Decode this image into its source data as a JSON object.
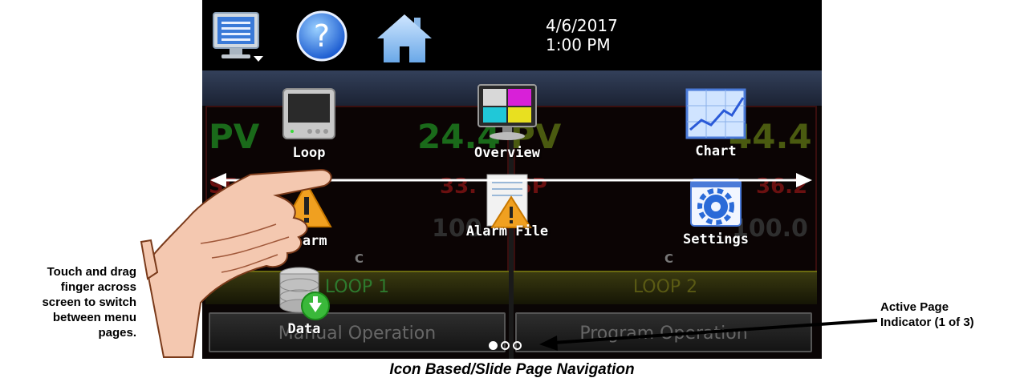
{
  "annotations": {
    "left_lines": [
      "Touch and drag",
      "finger across",
      "screen to switch",
      "between menu",
      "pages."
    ],
    "right_lines": [
      "Active Page",
      "Indicator (1 of 3)"
    ],
    "caption": "Icon Based/Slide Page Navigation"
  },
  "topbar": {
    "date": "4/6/2017",
    "time": "1:00 PM",
    "icons": [
      "monitor-menu-icon",
      "help-icon",
      "home-icon"
    ]
  },
  "background": {
    "loop1": {
      "pv_label": "PV",
      "pv_value": "24.4",
      "sp_label": "SP",
      "sp_value": "33.",
      "out_value": "100.",
      "unit": "C",
      "label": "LOOP 1"
    },
    "loop2": {
      "pv_label": "PV",
      "pv_value": "44.4",
      "sp_label": "SP",
      "sp_value": "36.2",
      "out_value": "100.0",
      "unit": "C",
      "label": "LOOP 2"
    },
    "buttons": [
      "Manual Operation",
      "Program Operation"
    ]
  },
  "menu": {
    "items": [
      {
        "label": "Loop",
        "icon": "loop-controller-icon"
      },
      {
        "label": "Overview",
        "icon": "overview-monitor-icon"
      },
      {
        "label": "Chart",
        "icon": "chart-icon"
      },
      {
        "label": "Alarm",
        "icon": "alarm-warning-icon"
      },
      {
        "label": "Alarm File",
        "icon": "alarm-file-icon"
      },
      {
        "label": "Settings",
        "icon": "settings-gear-icon"
      },
      {
        "label": "Data",
        "icon": "data-database-icon"
      }
    ]
  },
  "page_indicator": {
    "current": 1,
    "total": 3
  },
  "colors": {
    "pv_green": "#1f7a1f",
    "sp_red": "#7a1010",
    "loop_label": "#3a8a3a",
    "bluebar": "#2a3550",
    "arrow": "#ffffff"
  }
}
